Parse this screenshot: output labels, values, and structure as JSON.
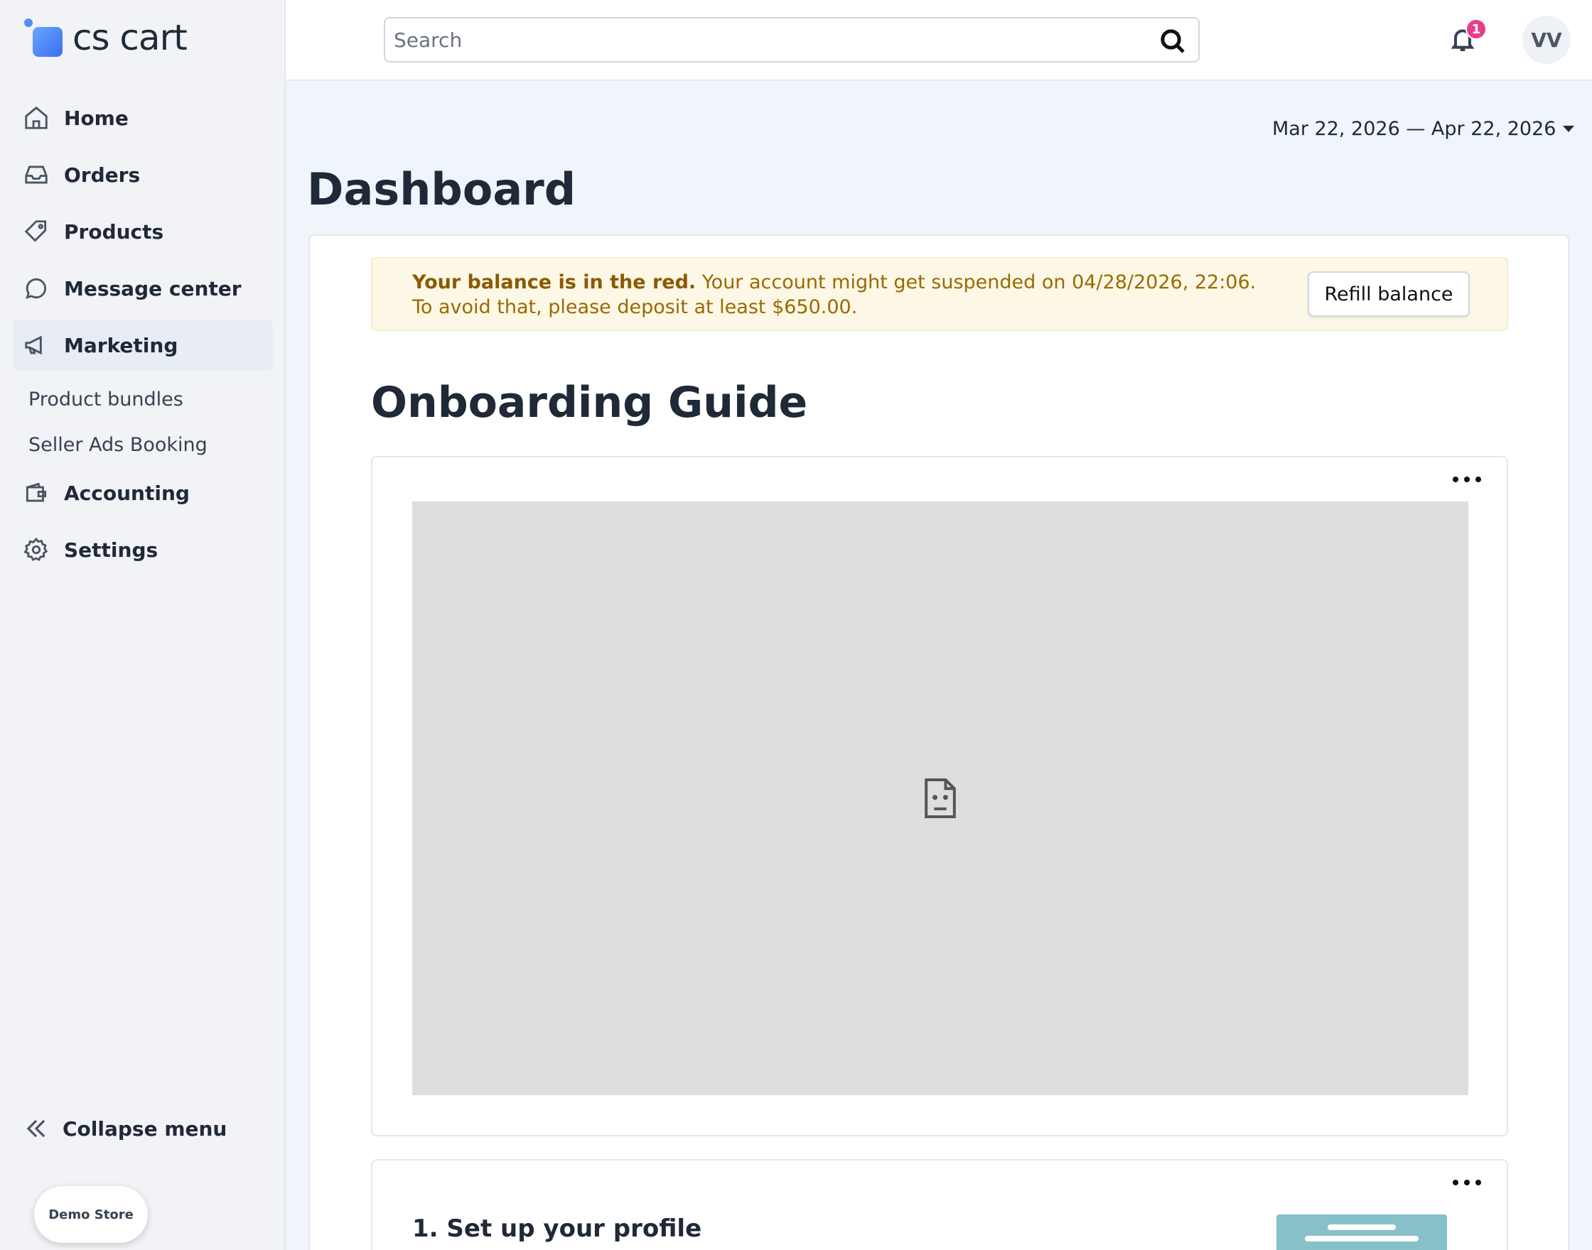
{
  "app": {
    "logo_text": "cs cart"
  },
  "sidebar": {
    "items": [
      {
        "label": "Home",
        "icon": "home-icon"
      },
      {
        "label": "Orders",
        "icon": "inbox-icon"
      },
      {
        "label": "Products",
        "icon": "tag-icon"
      },
      {
        "label": "Message center",
        "icon": "chat-icon"
      },
      {
        "label": "Marketing",
        "icon": "megaphone-icon",
        "active": true
      },
      {
        "label": "Accounting",
        "icon": "wallet-icon"
      },
      {
        "label": "Settings",
        "icon": "gear-icon"
      }
    ],
    "marketing_sub": [
      "Product bundles",
      "Seller Ads Booking"
    ],
    "collapse_label": "Collapse menu",
    "store_label": "Demo Store"
  },
  "topbar": {
    "search_placeholder": "Search",
    "notification_count": "1",
    "avatar_initials": "VV"
  },
  "main": {
    "date_range": "Mar 22, 2026 — Apr 22, 2026",
    "page_title": "Dashboard",
    "alert": {
      "bold": "Your balance is in the red.",
      "text": " Your account might get suspended on 04/28/2026, 22:06. To avoid that, please deposit at least $650.00.",
      "button": "Refill balance",
      "color": "#9a6a00",
      "background": "#fdf7e6"
    },
    "guide_title": "Onboarding Guide",
    "step1_title": "1. Set up your profile"
  }
}
